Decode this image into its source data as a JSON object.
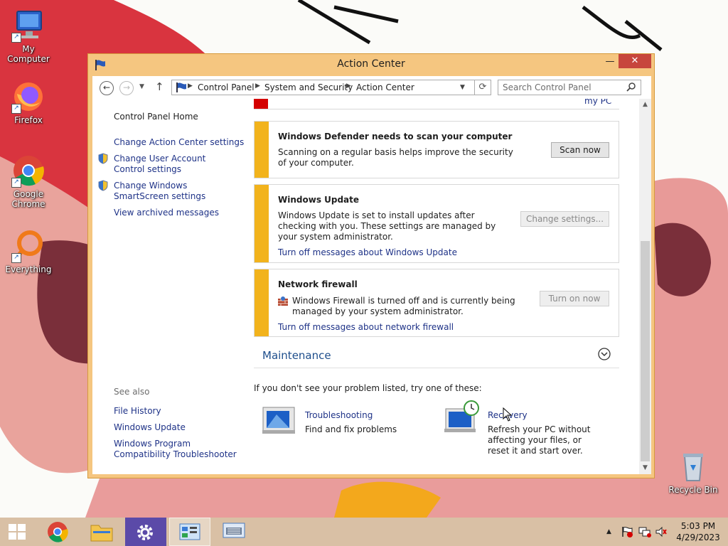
{
  "desktop": {
    "icons": [
      {
        "label": "My Computer"
      },
      {
        "label": "Firefox"
      },
      {
        "label": "Google Chrome"
      },
      {
        "label": "Everything"
      },
      {
        "label": "Recycle Bin"
      }
    ]
  },
  "window": {
    "title": "Action Center",
    "controls": {
      "minimize": "—",
      "maximize": "☐",
      "close": "✕"
    }
  },
  "address": {
    "crumbs": [
      "Control Panel",
      "System and Security",
      "Action Center"
    ],
    "search_placeholder": "Search Control Panel"
  },
  "sidebar": {
    "home": "Control Panel Home",
    "links": [
      "Change Action Center settings",
      "Change User Account Control settings",
      "Change Windows SmartScreen settings",
      "View archived messages"
    ],
    "see_also_label": "See also",
    "see_also": [
      "File History",
      "Windows Update",
      "Windows Program Compatibility Troubleshooter"
    ]
  },
  "security": {
    "partial_link": "my PC",
    "panels": [
      {
        "title": "Windows Defender needs to scan your computer",
        "text": "Scanning on a regular basis helps improve the security of your computer.",
        "button": "Scan now",
        "button_enabled": true,
        "link": ""
      },
      {
        "title": "Windows Update",
        "text": "Windows Update is set to install updates after checking with you.  These settings are managed by your system administrator.",
        "button": "Change settings...",
        "button_enabled": false,
        "link": "Turn off messages about Windows Update"
      },
      {
        "title": "Network firewall",
        "text": "Windows Firewall is turned off and is currently being managed by your system administrator.",
        "button": "Turn on now",
        "button_enabled": false,
        "link": "Turn off messages about network firewall"
      }
    ]
  },
  "maintenance": {
    "heading": "Maintenance"
  },
  "help": {
    "prompt": "If you don't see your problem listed, try one of these:",
    "tools": [
      {
        "title": "Troubleshooting",
        "text": "Find and fix problems"
      },
      {
        "title": "Recovery",
        "text": "Refresh your PC without affecting your files, or reset it and start over."
      }
    ]
  },
  "taskbar": {
    "time": "5:03 PM",
    "date": "4/29/2023"
  },
  "colors": {
    "window_frame": "#f5c680",
    "warning_bar": "#f2b31c",
    "link": "#1e3287",
    "critical": "#d40000",
    "close_button": "#c7463d"
  }
}
